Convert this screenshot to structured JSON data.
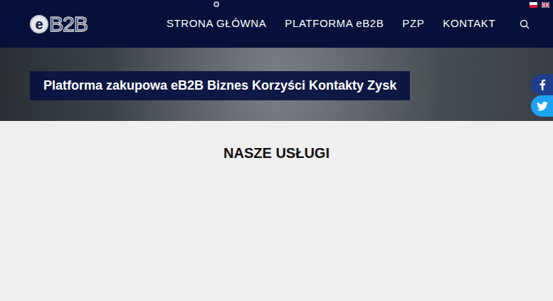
{
  "header": {
    "logo": {
      "mark": "e",
      "text": "B2B"
    },
    "nav": [
      {
        "label": "STRONA GŁÓWNA",
        "selected": true
      },
      {
        "label": "PLATFORMA eB2B",
        "selected": false
      },
      {
        "label": "PZP",
        "selected": false
      },
      {
        "label": "KONTAKT",
        "selected": false
      }
    ]
  },
  "hero": {
    "banner": "Platforma zakupowa eB2B Biznes Korzyści Kontakty Zysk"
  },
  "section": {
    "title": "NASZE USŁUGI"
  }
}
